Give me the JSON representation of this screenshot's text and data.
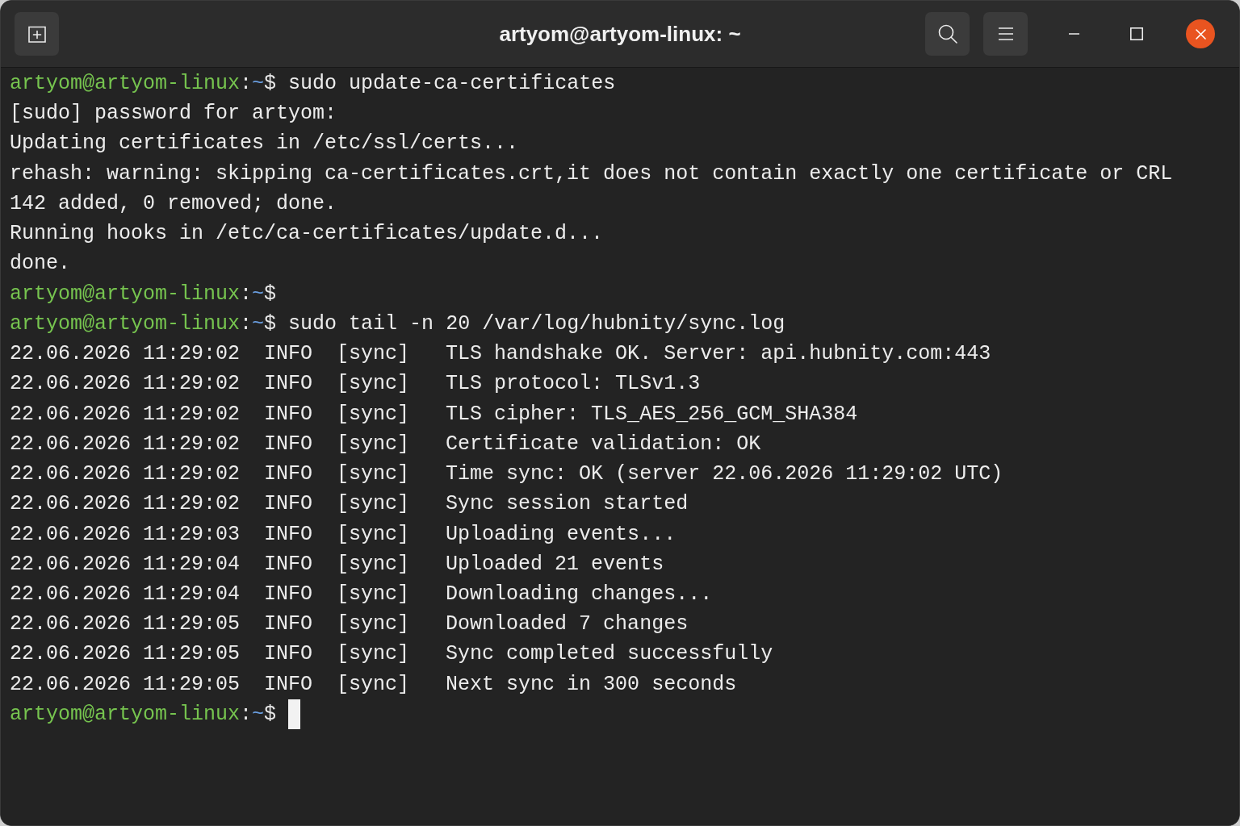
{
  "window": {
    "title": "artyom@artyom-linux: ~"
  },
  "terminal": {
    "lines": [
      {
        "kind": "prompt",
        "user_host": "artyom@artyom-linux",
        "colon": ":",
        "cwd": "~",
        "sign": "$",
        "command": "sudo update-ca-certificates"
      },
      {
        "kind": "output",
        "text": "[sudo] password for artyom:"
      },
      {
        "kind": "output",
        "text": "Updating certificates in /etc/ssl/certs..."
      },
      {
        "kind": "output",
        "text": "rehash: warning: skipping ca-certificates.crt,it does not contain exactly one certificate or CRL"
      },
      {
        "kind": "output",
        "text": "142 added, 0 removed; done."
      },
      {
        "kind": "output",
        "text": "Running hooks in /etc/ca-certificates/update.d..."
      },
      {
        "kind": "output",
        "text": "done."
      },
      {
        "kind": "prompt",
        "user_host": "artyom@artyom-linux",
        "colon": ":",
        "cwd": "~",
        "sign": "$"
      },
      {
        "kind": "prompt",
        "user_host": "artyom@artyom-linux",
        "colon": ":",
        "cwd": "~",
        "sign": "$",
        "command": "sudo tail -n 20 /var/log/hubnity/sync.log"
      },
      {
        "kind": "output",
        "text": "22.06.2026 11:29:02  INFO  [sync]   TLS handshake OK. Server: api.hubnity.com:443"
      },
      {
        "kind": "output",
        "text": "22.06.2026 11:29:02  INFO  [sync]   TLS protocol: TLSv1.3"
      },
      {
        "kind": "output",
        "text": "22.06.2026 11:29:02  INFO  [sync]   TLS cipher: TLS_AES_256_GCM_SHA384"
      },
      {
        "kind": "output",
        "text": "22.06.2026 11:29:02  INFO  [sync]   Certificate validation: OK"
      },
      {
        "kind": "output",
        "text": "22.06.2026 11:29:02  INFO  [sync]   Time sync: OK (server 22.06.2026 11:29:02 UTC)"
      },
      {
        "kind": "output",
        "text": "22.06.2026 11:29:02  INFO  [sync]   Sync session started"
      },
      {
        "kind": "output",
        "text": "22.06.2026 11:29:03  INFO  [sync]   Uploading events..."
      },
      {
        "kind": "output",
        "text": "22.06.2026 11:29:04  INFO  [sync]   Uploaded 21 events"
      },
      {
        "kind": "output",
        "text": "22.06.2026 11:29:04  INFO  [sync]   Downloading changes..."
      },
      {
        "kind": "output",
        "text": "22.06.2026 11:29:05  INFO  [sync]   Downloaded 7 changes"
      },
      {
        "kind": "output",
        "text": "22.06.2026 11:29:05  INFO  [sync]   Sync completed successfully"
      },
      {
        "kind": "output",
        "text": "22.06.2026 11:29:05  INFO  [sync]   Next sync in 300 seconds"
      },
      {
        "kind": "prompt",
        "user_host": "artyom@artyom-linux",
        "colon": ":",
        "cwd": "~",
        "sign": "$",
        "cursor": true
      }
    ]
  }
}
